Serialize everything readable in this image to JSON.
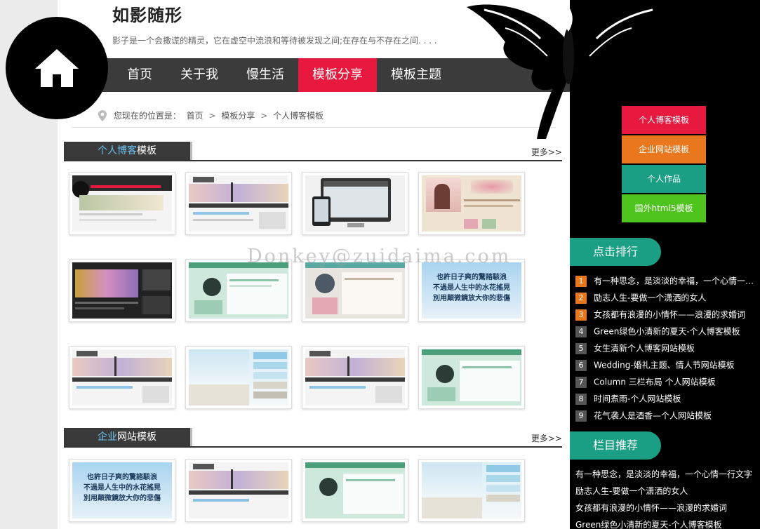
{
  "site": {
    "title": "如影随形",
    "subtitle": "影子是一个会撒谎的精灵，它在虚空中流浪和等待被发现之间;在存在与不存在之间. . . ."
  },
  "nav": {
    "items": [
      {
        "label": "首页"
      },
      {
        "label": "关于我"
      },
      {
        "label": "慢生活"
      },
      {
        "label": "模板分享"
      },
      {
        "label": "模板主题"
      }
    ],
    "active_index": 3
  },
  "breadcrumb": {
    "prefix": "您现在的位置是：",
    "items": [
      "首页",
      "模板分享",
      "个人博客模板"
    ],
    "separator": ">"
  },
  "sections": [
    {
      "title_highlight": "个人博客",
      "title_rest": "模板",
      "more": "更多>>"
    },
    {
      "title_highlight": "企业",
      "title_rest": "网站模板",
      "more": "更多>>"
    }
  ],
  "watermark": "Donkey@zuidaima.com",
  "calligraphy": {
    "line1": "也許日子爽的驚諮駭浪",
    "line2": "不過是人生中的水花搖晃",
    "line3": "別用顛微鏡放大你的悲傷"
  },
  "categories": [
    {
      "label": "个人博客模板",
      "color": "#e8193f"
    },
    {
      "label": "企业网站模板",
      "color": "#e9771d"
    },
    {
      "label": "个人作品",
      "color": "#1a9f84"
    },
    {
      "label": "国外html5模板",
      "color": "#4fc31e"
    }
  ],
  "ranking": {
    "title": "点击排行",
    "items": [
      {
        "num": "1",
        "text": "有一种思念，是淡淡的幸福，一个心情一…"
      },
      {
        "num": "2",
        "text": "励志人生-要做一个潇洒的女人"
      },
      {
        "num": "3",
        "text": "女孩都有浪漫的小情怀——浪漫的求婚词"
      },
      {
        "num": "4",
        "text": "Green绿色小清新的夏天-个人博客模板"
      },
      {
        "num": "5",
        "text": "女生清新个人博客网站模板"
      },
      {
        "num": "6",
        "text": "Wedding-婚礼主题、情人节网站模板"
      },
      {
        "num": "7",
        "text": "Column 三栏布局 个人网站模板"
      },
      {
        "num": "8",
        "text": "时间煮雨-个人网站模板"
      },
      {
        "num": "9",
        "text": "花气袭人是酒香—个人网站模板"
      }
    ]
  },
  "recommend": {
    "title": "栏目推荐",
    "items": [
      "有一种思念，是淡淡的幸福，一个心情一行文字",
      "励志人生-要做一个潇洒的女人",
      "女孩都有浪漫的小情怀——浪漫的求婚词",
      "Green绿色小清新的夏天-个人博客模板"
    ]
  },
  "colors": {
    "nav_bg": "#3b3b3b",
    "nav_active": "#e8193f",
    "sidebar_bg": "#000000",
    "side_head": "#1a9f84",
    "rank_top": "#e9771d"
  }
}
